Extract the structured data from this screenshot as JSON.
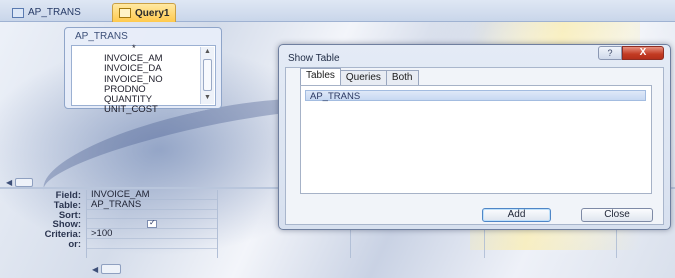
{
  "tabs": [
    {
      "label": "AP_TRANS"
    },
    {
      "label": "Query1"
    }
  ],
  "field_list": {
    "title": "AP_TRANS",
    "items": [
      "*",
      "INVOICE_AM",
      "INVOICE_DA",
      "INVOICE_NO",
      "PRODNO",
      "QUANTITY",
      "UNIT_COST"
    ]
  },
  "grid": {
    "row_labels": [
      "Field:",
      "Table:",
      "Sort:",
      "Show:",
      "Criteria:",
      "or:"
    ],
    "column1": {
      "field": "INVOICE_AM",
      "table": "AP_TRANS",
      "sort": "",
      "show": true,
      "criteria": ">100",
      "or": ""
    },
    "scroll_label": "|||||"
  },
  "show_table_dialog": {
    "title": "Show Table",
    "help_label": "?",
    "close_glyph": "X",
    "tabs": [
      "Tables",
      "Queries",
      "Both"
    ],
    "active_tab": "Tables",
    "list_items": [
      "AP_TRANS"
    ],
    "selected_item": "AP_TRANS",
    "add_label": "Add",
    "close_label": "Close"
  },
  "colors": {
    "active_tab": "#ffc94d",
    "dialog_close": "#c23a22",
    "selection": "#c7d8f2"
  }
}
